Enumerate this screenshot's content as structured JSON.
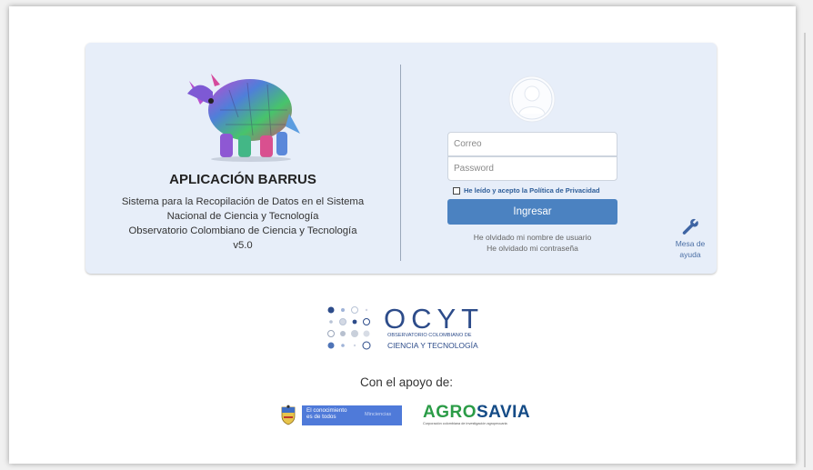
{
  "app": {
    "title": "APLICACIÓN BARRUS",
    "description_lines": [
      "Sistema para la Recopilación de Datos en el Sistema",
      "Nacional de Ciencia y Tecnología",
      "Observatorio Colombiano de Ciencia y Tecnología",
      "v5.0"
    ]
  },
  "login": {
    "email_placeholder": "Correo",
    "password_placeholder": "Password",
    "privacy_label": "He leído y acepto la Política de Privacidad",
    "privacy_checked": false,
    "submit_label": "Ingresar",
    "forgot_username": "He olvidado mi nombre de usuario",
    "forgot_password": "He olvidado mi contraseña"
  },
  "help": {
    "icon": "wrench-icon",
    "label_line1": "Mesa de",
    "label_line2": "ayuda"
  },
  "ocyt": {
    "word": "OCYT",
    "subtitle_line1": "OBSERVATORIO COLOMBIANO DE",
    "subtitle_line2": "CIENCIA Y TECNOLOGÍA"
  },
  "support": {
    "heading": "Con el apoyo de:",
    "gov_line1": "El conocimiento",
    "gov_line2": "es de todos",
    "gov_ministry": "Minciencias",
    "agro_part1": "AGRO",
    "agro_part2": "SAVIA",
    "agro_tagline": "Corporación colombiana de investigación agropecuaria"
  },
  "colors": {
    "card_bg": "#e7eef9",
    "button": "#4b82c1",
    "ocyt_blue": "#2d4c8a",
    "agro_green": "#2b9c47",
    "agro_blue": "#144b86"
  }
}
